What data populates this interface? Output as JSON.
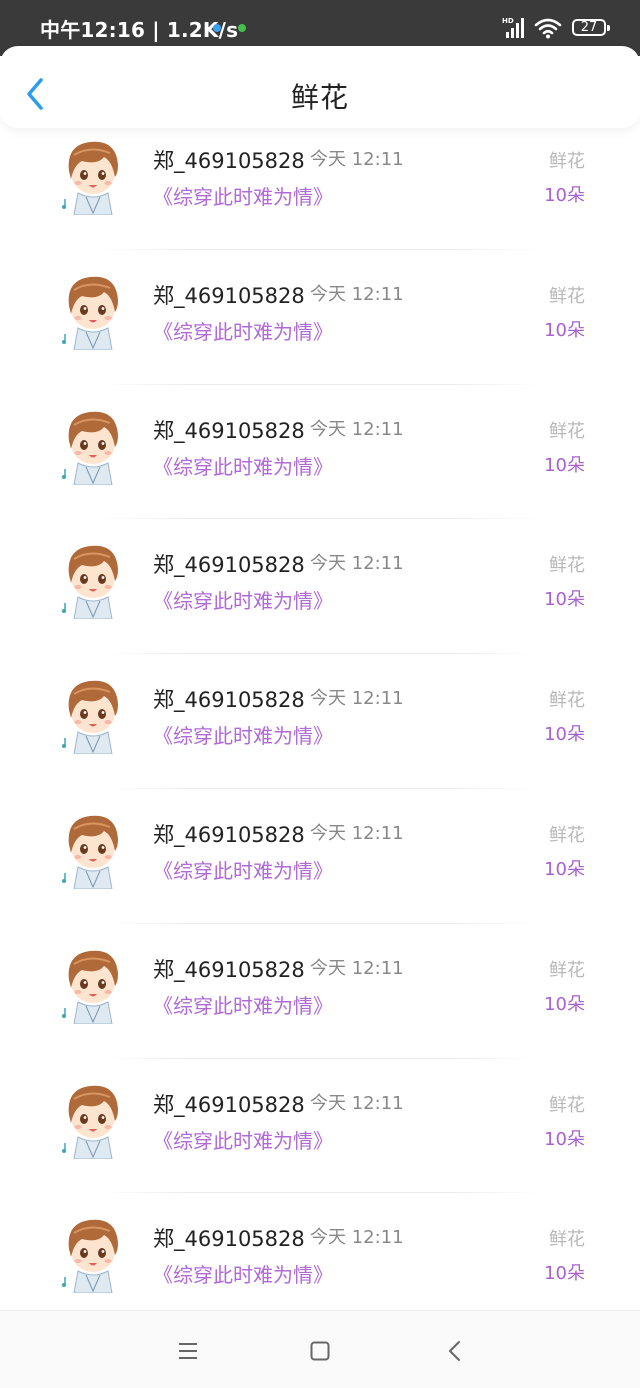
{
  "status_bar": {
    "left_text": "中午12:16 | 1.2K/s",
    "battery": "27",
    "network_label": "HD"
  },
  "header": {
    "title": "鲜花",
    "accent_color": "#2a9df0"
  },
  "colors": {
    "book_title": "#b06ad6",
    "gift_count": "#a862d0",
    "muted": "#b8b8b8"
  },
  "records": [
    {
      "user": "郑_469105828",
      "time": "今天 12:11",
      "book": "《综穿此时难为情》",
      "gift": "鲜花",
      "count": "10朵"
    },
    {
      "user": "郑_469105828",
      "time": "今天 12:11",
      "book": "《综穿此时难为情》",
      "gift": "鲜花",
      "count": "10朵"
    },
    {
      "user": "郑_469105828",
      "time": "今天 12:11",
      "book": "《综穿此时难为情》",
      "gift": "鲜花",
      "count": "10朵"
    },
    {
      "user": "郑_469105828",
      "time": "今天 12:11",
      "book": "《综穿此时难为情》",
      "gift": "鲜花",
      "count": "10朵"
    },
    {
      "user": "郑_469105828",
      "time": "今天 12:11",
      "book": "《综穿此时难为情》",
      "gift": "鲜花",
      "count": "10朵"
    },
    {
      "user": "郑_469105828",
      "time": "今天 12:11",
      "book": "《综穿此时难为情》",
      "gift": "鲜花",
      "count": "10朵"
    },
    {
      "user": "郑_469105828",
      "time": "今天 12:11",
      "book": "《综穿此时难为情》",
      "gift": "鲜花",
      "count": "10朵"
    },
    {
      "user": "郑_469105828",
      "time": "今天 12:11",
      "book": "《综穿此时难为情》",
      "gift": "鲜花",
      "count": "10朵"
    },
    {
      "user": "郑_469105828",
      "time": "今天 12:11",
      "book": "《综穿此时难为情》",
      "gift": "鲜花",
      "count": "10朵"
    }
  ],
  "nav_bar": {
    "icons": [
      "menu-icon",
      "home-square-icon",
      "back-chevron-icon"
    ]
  }
}
